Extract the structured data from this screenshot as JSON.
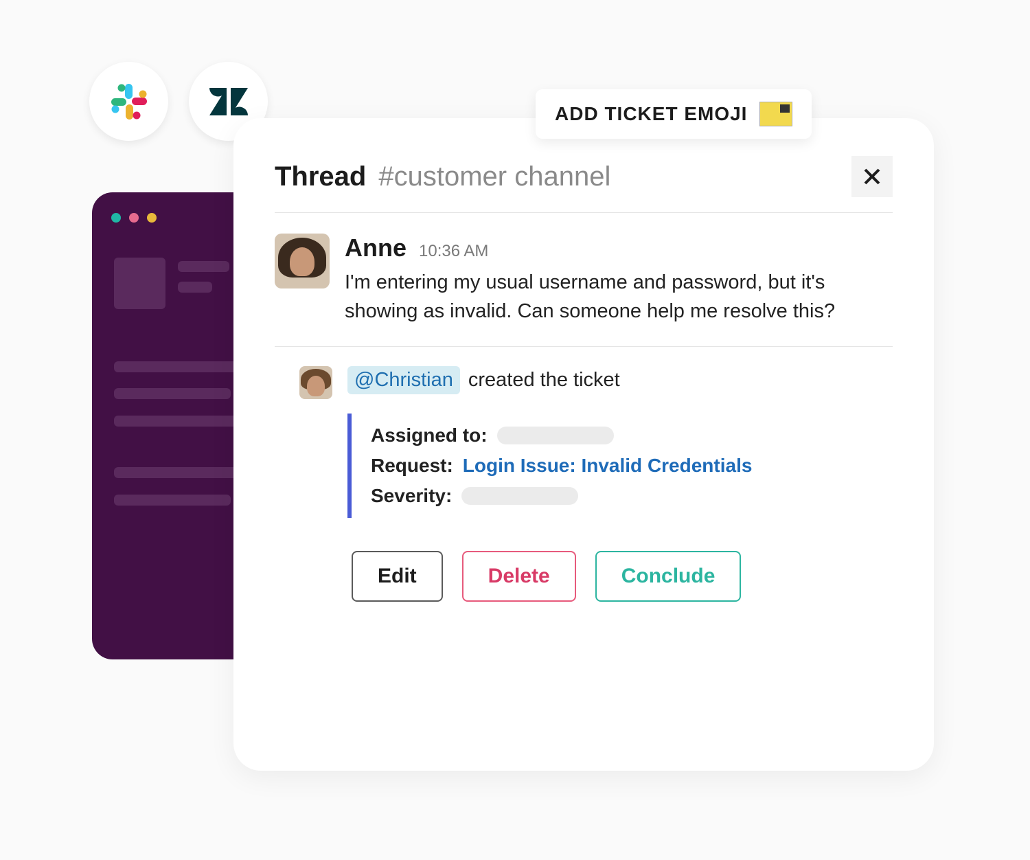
{
  "banner": {
    "label": "ADD TICKET EMOJI"
  },
  "thread": {
    "title": "Thread",
    "channel": "#customer channel"
  },
  "message": {
    "author": "Anne",
    "time": "10:36 AM",
    "text": "I'm entering my usual username and password, but it's showing as invalid. Can someone help me resolve this?"
  },
  "reply": {
    "mention": "@Christian",
    "action_text": "created the ticket"
  },
  "ticket": {
    "assigned_label": "Assigned to:",
    "request_label": "Request:",
    "request_value": "Login Issue: Invalid Credentials",
    "severity_label": "Severity:"
  },
  "actions": {
    "edit": "Edit",
    "delete": "Delete",
    "conclude": "Conclude"
  }
}
